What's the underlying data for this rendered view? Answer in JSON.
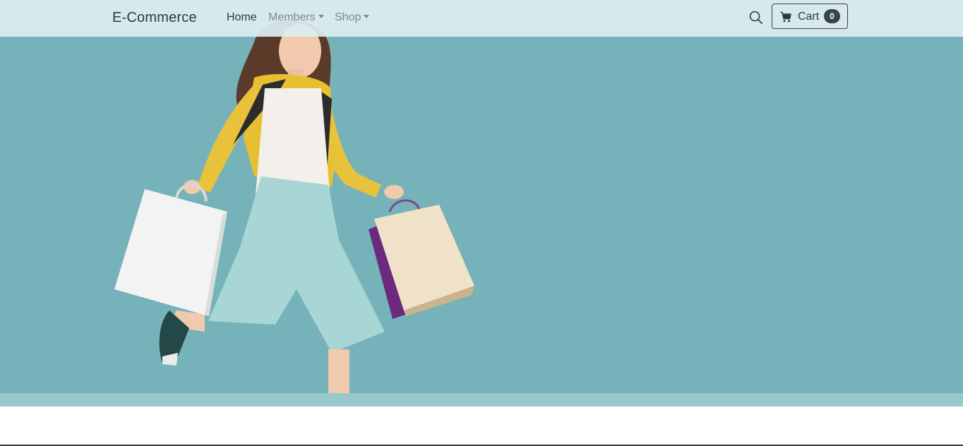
{
  "navbar": {
    "brand": "E-Commerce",
    "links": [
      {
        "label": "Home"
      },
      {
        "label": "Members"
      },
      {
        "label": "Shop"
      }
    ],
    "search_icon": "search-icon",
    "cart": {
      "label": "Cart",
      "count": "0",
      "icon": "cart-icon"
    }
  },
  "hero": {
    "image": "woman-with-shopping-bags",
    "background_color": "#76b2b9",
    "strip_color": "#97c8ce"
  }
}
